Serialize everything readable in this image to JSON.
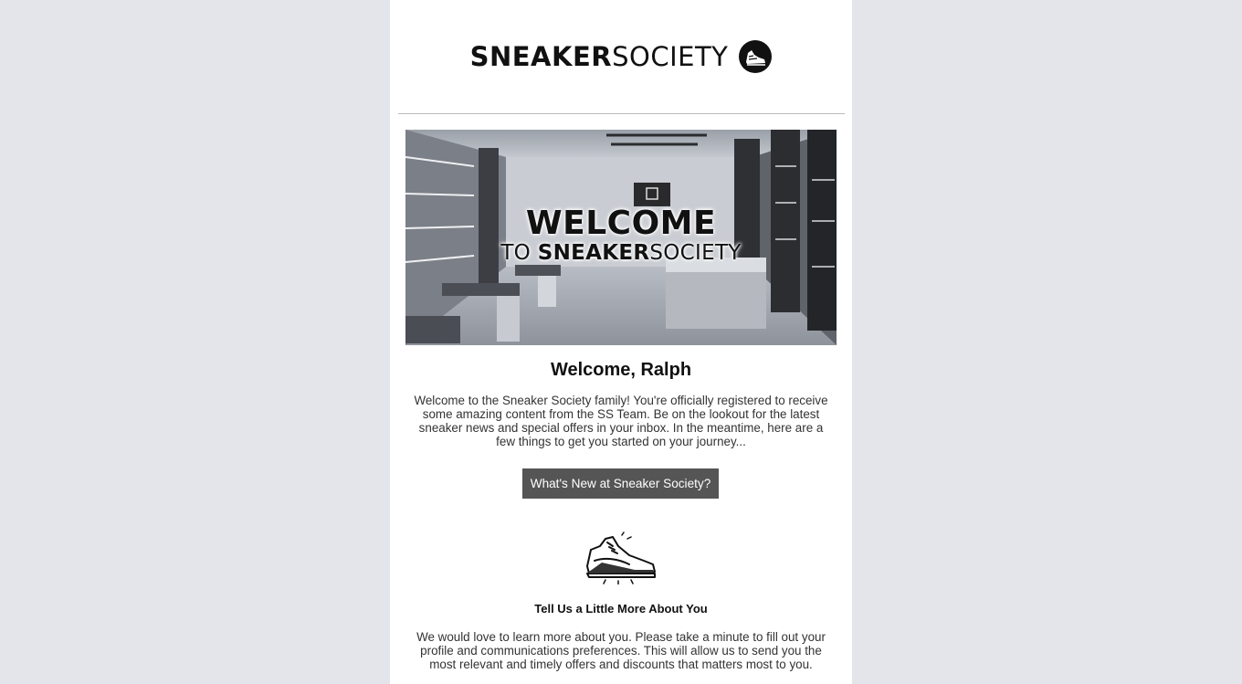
{
  "brand": {
    "name_bold": "SNEAKER",
    "name_light": "SOCIETY",
    "logo_icon": "sneaker-circle-logo"
  },
  "hero": {
    "line1": "WELCOME",
    "line2_prefix": "TO ",
    "line2_bold": "SNEAKER",
    "line2_light": "SOCIETY"
  },
  "greeting": {
    "title": "Welcome, Ralph",
    "body": "Welcome to the Sneaker Society family! You're officially registered to receive some amazing content from the SS Team. Be on the lookout for the latest sneaker news and special offers in your inbox. In the meantime, here are a few things to get you started on your journey..."
  },
  "cta": {
    "label": "What's New at Sneaker Society?"
  },
  "about": {
    "icon": "sneaker-icon",
    "title": "Tell Us a Little More About You",
    "body": "We would love to learn more about you. Please take a minute to fill out your profile and communications preferences. This will allow us to send you the most relevant and timely offers and discounts that matters most to you."
  },
  "colors": {
    "page_bg": "#e3e5ea",
    "card_bg": "#ffffff",
    "button_bg": "#555555"
  }
}
